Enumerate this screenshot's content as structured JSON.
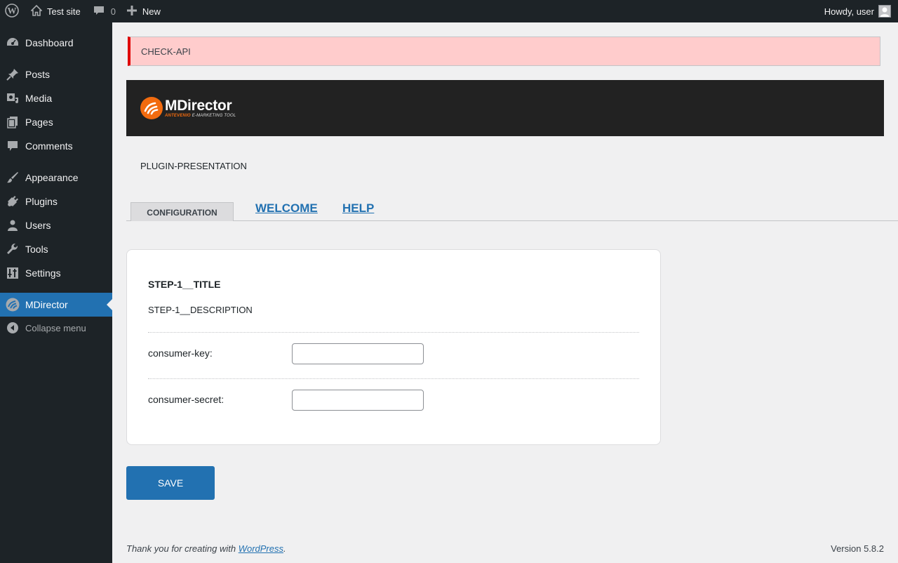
{
  "admin_bar": {
    "site_name": "Test site",
    "comments_count": "0",
    "new_label": "New",
    "howdy": "Howdy, user"
  },
  "sidebar": {
    "items": [
      {
        "label": "Dashboard",
        "icon": "dashboard-icon"
      },
      {
        "label": "Posts",
        "icon": "pin-icon"
      },
      {
        "label": "Media",
        "icon": "media-icon"
      },
      {
        "label": "Pages",
        "icon": "pages-icon"
      },
      {
        "label": "Comments",
        "icon": "comment-icon"
      },
      {
        "label": "Appearance",
        "icon": "brush-icon"
      },
      {
        "label": "Plugins",
        "icon": "plug-icon"
      },
      {
        "label": "Users",
        "icon": "user-icon"
      },
      {
        "label": "Tools",
        "icon": "wrench-icon"
      },
      {
        "label": "Settings",
        "icon": "sliders-icon"
      },
      {
        "label": "MDirector",
        "icon": "mdirector-icon",
        "current": true
      }
    ],
    "collapse_label": "Collapse menu"
  },
  "notice": {
    "text": "CHECK-API"
  },
  "banner": {
    "logo_name": "MDirector",
    "logo_sub_brand": "ANTEVENIO",
    "logo_sub_rest": "E-MARKETING TOOL"
  },
  "presentation": "PLUGIN-PRESENTATION",
  "tabs": {
    "active": "CONFIGURATION",
    "welcome": "WELCOME",
    "help": "HELP"
  },
  "step": {
    "title": "STEP-1__TITLE",
    "description": "STEP-1__DESCRIPTION"
  },
  "fields": {
    "consumer_key_label": "consumer-key:",
    "consumer_key_value": "",
    "consumer_secret_label": "consumer-secret:",
    "consumer_secret_value": ""
  },
  "save_label": "SAVE",
  "footer": {
    "thanks_prefix": "Thank you for creating with ",
    "wp_link": "WordPress",
    "thanks_suffix": ".",
    "version": "Version 5.8.2"
  },
  "colors": {
    "accent": "#2271b1",
    "sidebar_bg": "#1d2327",
    "notice_border": "#e00000",
    "notice_bg": "#ffcccc",
    "brand_orange": "#f26b0f"
  }
}
